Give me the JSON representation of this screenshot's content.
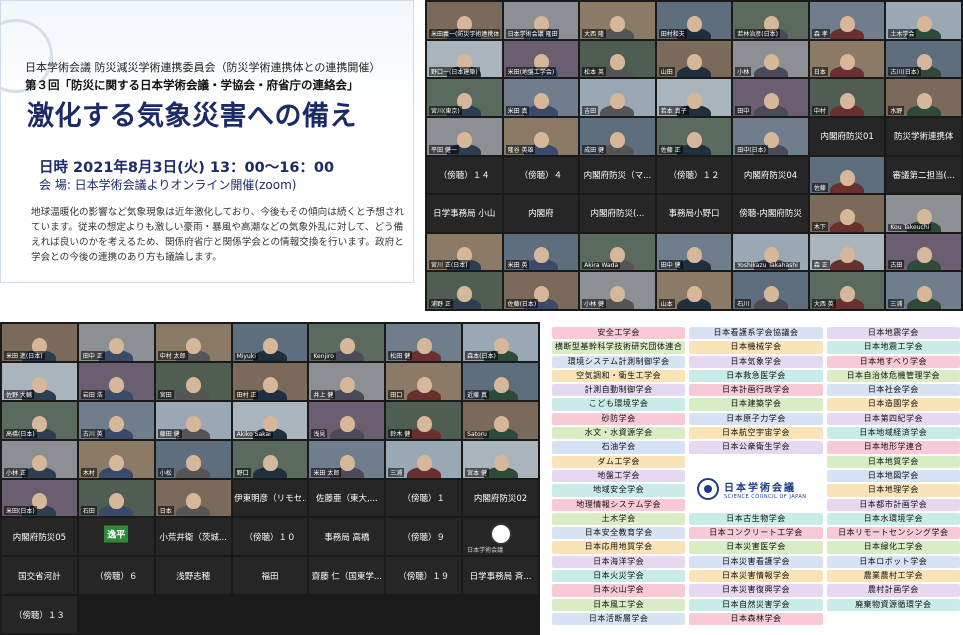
{
  "info": {
    "line1": "日本学術会議 防災減災学術連携委員会（防災学術連携体との連携開催）",
    "line2": "第３回「防災に関する日本学術会議・学協会・府省庁の連絡会」",
    "title": "激化する気象災害への備え",
    "date": "日時 2021年8月3日(火) 13：00～16：00",
    "venue": "会 場: 日本学術会議よりオンライン開催(zoom)",
    "body": "地球温暖化の影響など気象現象は近年激化しており、今後もその傾向は続くと予想されています。従来の想定よりも激しい豪雨・暴風や高潮などの気象外乱に対して、どう備えれば良いのかを考えるため、関係府省庁と関係学会との情報交換を行います。政府と学会との今後の連携のあり方も議論します。"
  },
  "zoom1": [
    "米田義一(防災学術連携体)",
    "日本学術会議 隆田",
    "大西 隆",
    "田村和夫",
    "若林治彦(日本)",
    "森 孝",
    "土木学会",
    "野口一(日本建築)",
    "米田(地盤工学会)",
    "松本 英",
    "山田",
    "小林",
    "日本",
    "古川(日本)",
    "宮川(東京)",
    "米田 真",
    "吉田",
    "若本 真子",
    "田中",
    "中村",
    "水野",
    "平田 健一",
    "隆谷 英雄",
    "成田 健",
    "佐藤 正",
    "田中(日本)",
    "内閣府防災01",
    "防災学術連携体",
    "（傍聴）１４",
    "（傍聴）４",
    "内閣府防災（マ...",
    "（傍聴）１２",
    "内閣府防災04",
    "佐藤",
    "審議第二担当(...",
    "日学事務局 小山",
    "内閣府",
    "内閣府防災(...",
    "事務局小野口",
    "傍聴-内閣府防災",
    "木下",
    "Kou Takeuchi",
    "宮川 正(日本)",
    "米田 英",
    "Akira Wada",
    "田中 健",
    "Yoshikazu Takahashi",
    "森 正",
    "古田",
    "浦野 正",
    "佐藤(日本)",
    "小林 健",
    "山本",
    "石川",
    "大西 英",
    "三浦"
  ],
  "zoom2": [
    "米田 進(日本)",
    "田中 正",
    "中村 太郎",
    "Miyuki",
    "Kenjiro",
    "松田 健",
    "森本(日本)",
    "佐野 大輔",
    "岩田 浩",
    "宮田",
    "田村 正",
    "井上 健",
    "田口",
    "近藤 真",
    "高橋(日本)",
    "古川 英",
    "藤田 健",
    "Akiko Sakai",
    "浅見",
    "鈴木 健",
    "Satoru",
    "小林 正",
    "木村",
    "小松",
    "野口",
    "米田 太郎",
    "三浦",
    "宮本 健",
    "米田(日本)",
    "石田",
    "日本",
    "伊東明彦（リモセ...",
    "佐藤亜（東大,...",
    "（傍聴）１",
    "内閣府防災02",
    "内閣府防災05",
    "逸平",
    "小荒井衛（茨城...",
    "（傍聴）１０",
    "事務局 高橋",
    "（傍聴）９",
    "日本学術会議",
    "国交省河計",
    "（傍聴）６",
    "浅野志穂",
    "福田",
    "齋藤 仁（国東学...",
    "（傍聴）１９",
    "日学事務局 斉...",
    "（傍聴）１３"
  ],
  "societies": {
    "left": [
      "安全工学会",
      "横断型基幹科学技術研究団体連合",
      "環境システム計測制御学会",
      "空気調和・衛生工学会",
      "計測自動制御学会",
      "こども環境学会",
      "砂防学会",
      "水文・水資源学会",
      "石油学会",
      "ダム工学会",
      "地盤工学会",
      "地域安全学会",
      "地理情報システム学会",
      "土木学会",
      "日本安全教育学会",
      "日本応用地質学会",
      "日本海洋学会",
      "日本火災学会",
      "日本火山学会",
      "日本風工学会",
      "日本活断層学会"
    ],
    "middle": [
      "日本看護系学会協議会",
      "日本機械学会",
      "日本気象学会",
      "日本救急医学会",
      "日本計画行政学会",
      "日本建築学会",
      "日本原子力学会",
      "日本航空宇宙学会",
      "日本公衆衛生学会",
      "日本古生物学会",
      "日本コンクリート工学会",
      "日本災害医学会",
      "日本災害看護学会",
      "日本災害情報学会",
      "日本災害復興学会",
      "日本自然災害学会",
      "日本森林学会"
    ],
    "right": [
      "日本地震学会",
      "日本地震工学会",
      "日本地すべり学会",
      "日本自治体危機管理学会",
      "日本社会学会",
      "日本造園学会",
      "日本第四紀学会",
      "日本地域経済学会",
      "日本地形学連合",
      "日本地質学会",
      "日本地図学会",
      "日本地理学会",
      "日本都市計画学会",
      "日本水環境学会",
      "日本リモートセンシング学会",
      "日本緑化工学会",
      "日本ロボット学会",
      "農業農村工学会",
      "農村計画学会",
      "廃棄物資源循環学会"
    ],
    "logo_name": "日本学術会議",
    "logo_en": "SCIENCE COUNCIL OF JAPAN"
  },
  "colors": {
    "title": "#1c2a66",
    "speaker_border": "#f5e31a",
    "society_palette": [
      "#f9c9d6",
      "#d9ecc4",
      "#d7e3f4",
      "#fbe3b8",
      "#e7d8f1",
      "#c9ece8"
    ]
  }
}
